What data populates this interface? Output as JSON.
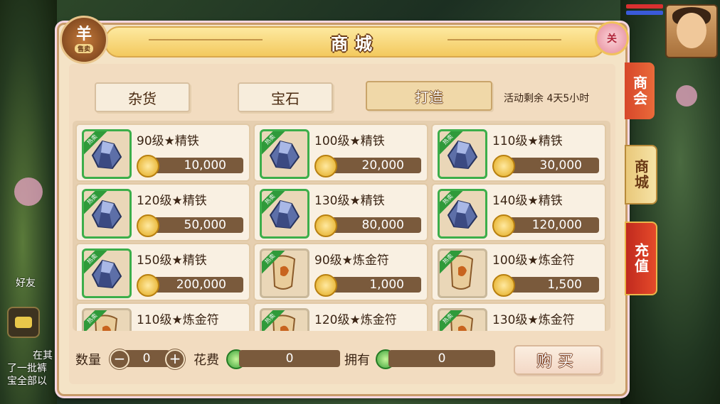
{
  "title": "商城",
  "emblem": {
    "top": "羊",
    "bottom": "售卖"
  },
  "close_label": "关",
  "tabs": [
    {
      "label": "杂货",
      "active": false
    },
    {
      "label": "宝石",
      "active": false
    },
    {
      "label": "打造",
      "active": true
    }
  ],
  "event_text": "活动剩余 4天5小时",
  "hot_badge": "热卖",
  "items": [
    {
      "name": "90级★精铁",
      "price": "10,000",
      "type": "ore"
    },
    {
      "name": "100级★精铁",
      "price": "20,000",
      "type": "ore"
    },
    {
      "name": "110级★精铁",
      "price": "30,000",
      "type": "ore"
    },
    {
      "name": "120级★精铁",
      "price": "50,000",
      "type": "ore"
    },
    {
      "name": "130级★精铁",
      "price": "80,000",
      "type": "ore"
    },
    {
      "name": "140级★精铁",
      "price": "120,000",
      "type": "ore"
    },
    {
      "name": "150级★精铁",
      "price": "200,000",
      "type": "ore"
    },
    {
      "name": "90级★炼金符",
      "price": "1,000",
      "type": "talisman"
    },
    {
      "name": "100级★炼金符",
      "price": "1,500",
      "type": "talisman"
    },
    {
      "name": "110级★炼金符",
      "price": "",
      "type": "talisman"
    },
    {
      "name": "120级★炼金符",
      "price": "",
      "type": "talisman"
    },
    {
      "name": "130级★炼金符",
      "price": "",
      "type": "talisman"
    }
  ],
  "bottom": {
    "qty_label": "数量",
    "qty_value": "0",
    "minus": "−",
    "plus": "+",
    "cost_label": "花费",
    "cost_value": "0",
    "own_label": "拥有",
    "own_value": "0",
    "buy_label": "购买"
  },
  "side_tabs": [
    "商会",
    "商城",
    "充值"
  ],
  "background_text": {
    "friend": "好友",
    "chat_line1": "在其",
    "chat_line2": "了一批裤",
    "chat_line3": "宝全部以"
  },
  "colors": {
    "hot_green": "#2f9a3a",
    "price_bar": "#7a5a3c",
    "panel": "#f4e3c6"
  }
}
